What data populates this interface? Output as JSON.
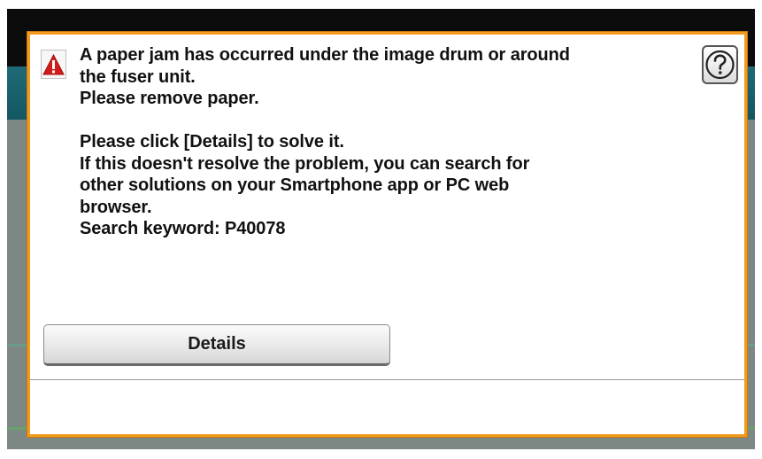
{
  "dialog": {
    "message_lines": [
      "A paper jam has occurred under the image drum or around",
      "the fuser unit.",
      "Please remove paper.",
      "",
      "Please click [Details] to solve it.",
      "If this doesn't resolve the problem, you can search for",
      "other solutions on your Smartphone app or PC web",
      "browser.",
      "Search keyword: P40078"
    ],
    "details_label": "Details",
    "warning_icon": "warning-triangle-icon",
    "help_icon": "question-mark-icon"
  },
  "colors": {
    "dialog_border": "#f29a1d",
    "warning_red": "#d21b1b",
    "header_teal": "#1e6a76",
    "background_gray": "#7d8784"
  }
}
